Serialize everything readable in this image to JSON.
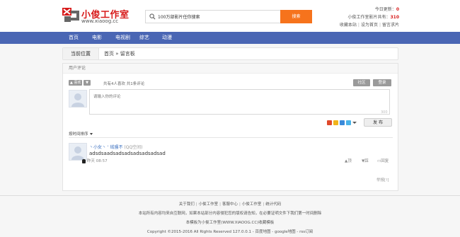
{
  "brand": {
    "name": "小俊工作室",
    "url": "www.xiaoog.cc",
    "color": "#d71a1a"
  },
  "search": {
    "value": "100万部影片任你搜索",
    "button_label": "搜索",
    "button_color": "#f6731c"
  },
  "header_right": {
    "updates_label": "今日更新：",
    "updates_count": "0",
    "total_label": "小俊工作室影片共有：",
    "total_count": "310",
    "links": [
      "收藏本站",
      "设为首页",
      "留言求片"
    ]
  },
  "nav": {
    "color": "#4a66b4",
    "items": [
      "首页",
      "电影",
      "电视剧",
      "综艺",
      "动漫"
    ]
  },
  "breadcrumb": {
    "title": "当前位置",
    "path": "首页 » 留言板"
  },
  "comments": {
    "header": "用户评论",
    "like_label": "喜欢",
    "dislike_label": "",
    "stats": "共有4人喜欢   共1条评论",
    "community_button": "社区",
    "login_button": "登录",
    "placeholder": "请输入你的评论",
    "char_count": "300",
    "publish_button": "发 布",
    "sort_label": "按时间排序",
    "items": [
      {
        "user": "丶小女丶 ' 绒骚不",
        "source": "(QQ空间)",
        "body": "adsdsaadsadsadsadsadsadsad",
        "time": "昨天 08:57",
        "actions": [
          "顶",
          "踩",
          "回复"
        ]
      }
    ],
    "report_label": "举报[!]"
  },
  "footer": {
    "links": [
      "关于我们",
      "小俊工作室",
      "客服中心",
      "小俊工作室",
      "统计代码"
    ],
    "disclaimer": "本站所有内容均来自互联网，如果本站部分内容侵犯您的版权请告知，在必要证明文件下我们第一时间删除",
    "template_note": "本模板为小俊工作室(WWW.XIAOOG.CC)收藏模板",
    "copyright": "Copyright ©2015-2016 All Rights Reserved 127.0.0.1 - 百度地图 - google地图 - rss订阅"
  }
}
